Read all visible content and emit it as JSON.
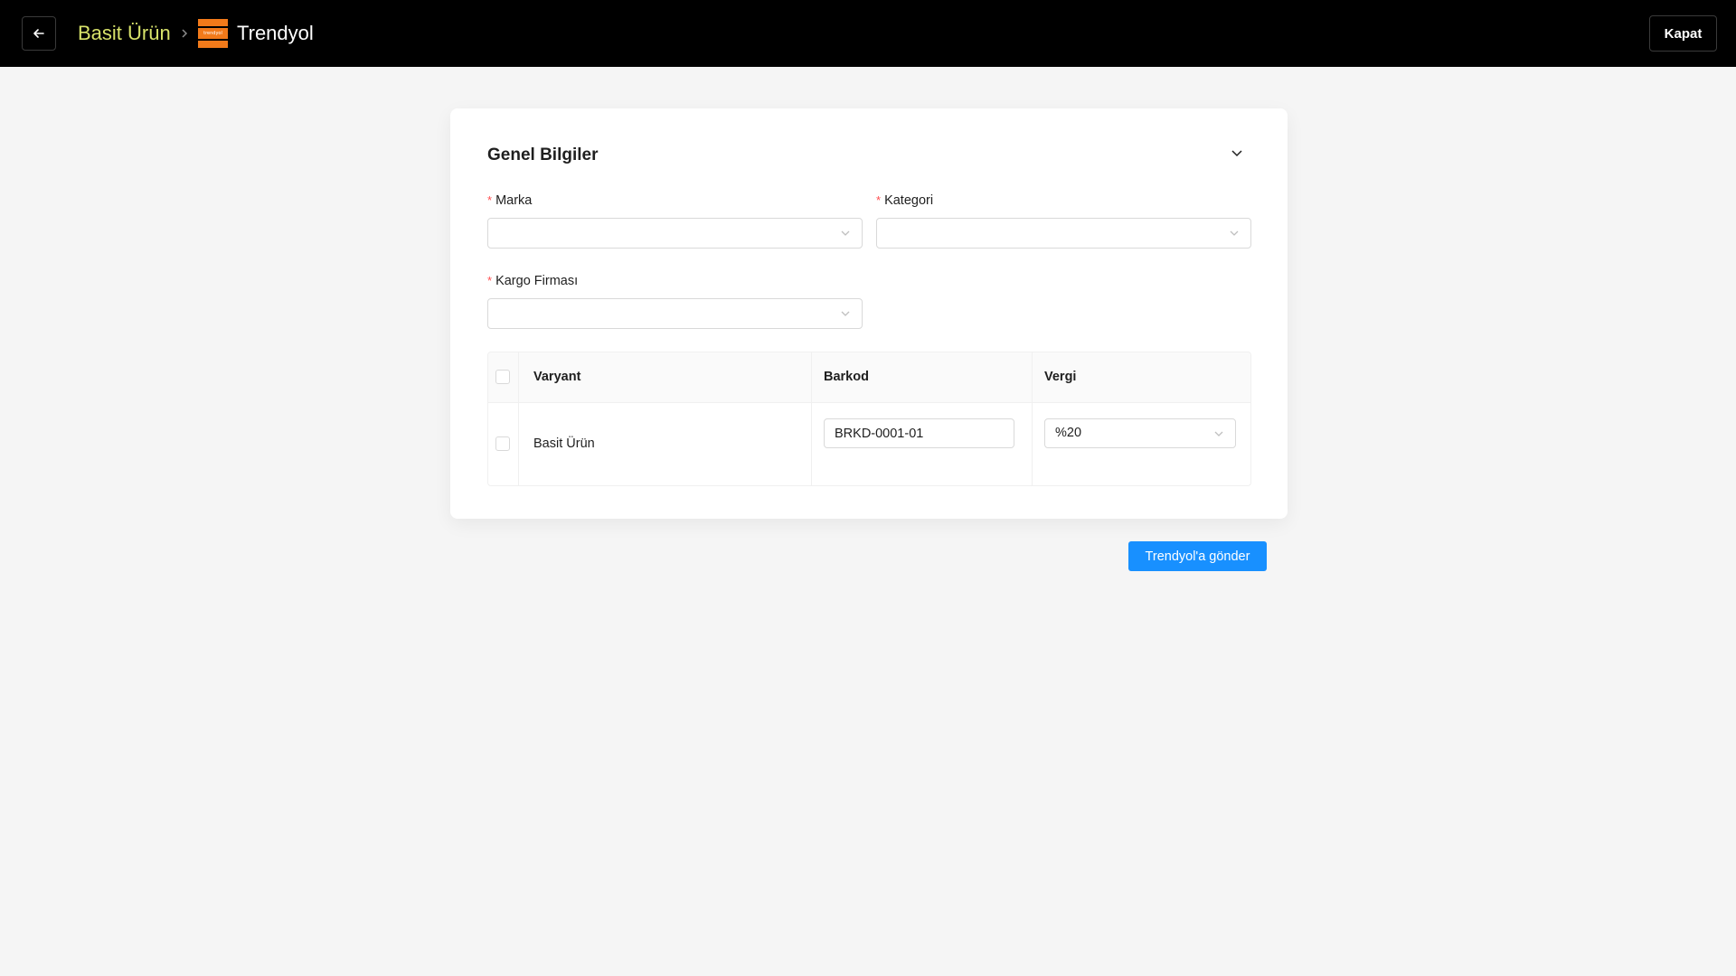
{
  "header": {
    "product_name": "Basit Ürün",
    "store_name": "Trendyol",
    "store_logo_text": "trendyol",
    "close_label": "Kapat",
    "accent": "#d8e36a",
    "brand_color": "#f27a1a"
  },
  "general": {
    "title": "Genel Bilgiler",
    "brand": {
      "label": "Marka",
      "value": ""
    },
    "category": {
      "label": "Kategori",
      "value": ""
    },
    "cargo": {
      "label": "Kargo Firması",
      "value": ""
    },
    "required_mark": "*"
  },
  "table": {
    "headers": {
      "variant": "Varyant",
      "barcode": "Barkod",
      "tax": "Vergi"
    },
    "rows": [
      {
        "variant": "Basit Ürün",
        "barcode": "BRKD-0001-01",
        "tax": "%20"
      }
    ]
  },
  "actions": {
    "send_label": "Trendyol'a gönder",
    "send_color": "#1890ff"
  }
}
